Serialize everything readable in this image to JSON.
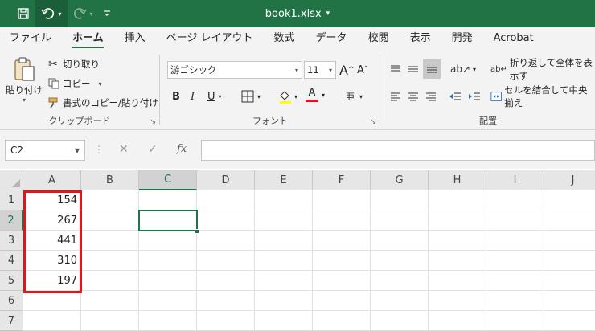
{
  "titlebar": {
    "filename": "book1.xlsx",
    "filename_caret": "▾",
    "save_icon": "save-icon",
    "undo_icon": "undo-icon",
    "redo_icon": "redo-icon",
    "customize_icon": "customize-qat-icon"
  },
  "tabs": [
    {
      "label": "ファイル"
    },
    {
      "label": "ホーム"
    },
    {
      "label": "挿入"
    },
    {
      "label": "ページ レイアウト"
    },
    {
      "label": "数式"
    },
    {
      "label": "データ"
    },
    {
      "label": "校閲"
    },
    {
      "label": "表示"
    },
    {
      "label": "開発"
    },
    {
      "label": "Acrobat"
    }
  ],
  "ribbon": {
    "clipboard": {
      "paste_label": "貼り付け",
      "cut_label": "切り取り",
      "copy_label": "コピー",
      "format_painter_label": "書式のコピー/貼り付け",
      "group_label": "クリップボード"
    },
    "font": {
      "font_name": "游ゴシック",
      "font_size": "11",
      "grow_label": "A",
      "shrink_label": "A",
      "bold_label": "B",
      "italic_label": "I",
      "underline_label": "U",
      "font_color_label": "A",
      "phonetic_label": "亜",
      "group_label": "フォント",
      "accent_color": "#e81123"
    },
    "alignment": {
      "wrap_text_label": "折り返して全体を表示す",
      "merge_center_label": "セルを結合して中央揃え",
      "group_label": "配置"
    }
  },
  "formula_bar": {
    "name_box": "C2",
    "fx_label": "fx",
    "cancel_label": "✕",
    "enter_label": "✓",
    "dots": "⋮",
    "formula": ""
  },
  "grid": {
    "columns": [
      "A",
      "B",
      "C",
      "D",
      "E",
      "F",
      "G",
      "H",
      "I",
      "J"
    ],
    "rows": [
      "1",
      "2",
      "3",
      "4",
      "5",
      "6",
      "7"
    ],
    "selected_cell": "C2",
    "column_a_values": [
      "154",
      "267",
      "441",
      "310",
      "197"
    ],
    "highlight_color": "#e0171a"
  }
}
